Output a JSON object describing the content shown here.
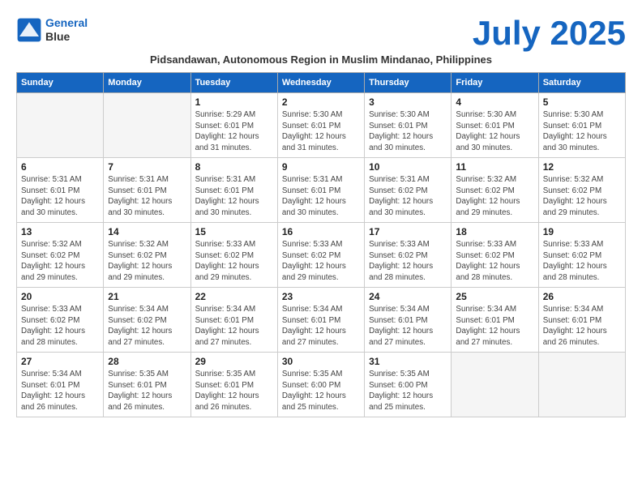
{
  "header": {
    "logo_line1": "General",
    "logo_line2": "Blue",
    "month_title": "July 2025",
    "subtitle": "Pidsandawan, Autonomous Region in Muslim Mindanao, Philippines"
  },
  "weekdays": [
    "Sunday",
    "Monday",
    "Tuesday",
    "Wednesday",
    "Thursday",
    "Friday",
    "Saturday"
  ],
  "weeks": [
    [
      {
        "day": "",
        "info": ""
      },
      {
        "day": "",
        "info": ""
      },
      {
        "day": "1",
        "info": "Sunrise: 5:29 AM\nSunset: 6:01 PM\nDaylight: 12 hours\nand 31 minutes."
      },
      {
        "day": "2",
        "info": "Sunrise: 5:30 AM\nSunset: 6:01 PM\nDaylight: 12 hours\nand 31 minutes."
      },
      {
        "day": "3",
        "info": "Sunrise: 5:30 AM\nSunset: 6:01 PM\nDaylight: 12 hours\nand 30 minutes."
      },
      {
        "day": "4",
        "info": "Sunrise: 5:30 AM\nSunset: 6:01 PM\nDaylight: 12 hours\nand 30 minutes."
      },
      {
        "day": "5",
        "info": "Sunrise: 5:30 AM\nSunset: 6:01 PM\nDaylight: 12 hours\nand 30 minutes."
      }
    ],
    [
      {
        "day": "6",
        "info": "Sunrise: 5:31 AM\nSunset: 6:01 PM\nDaylight: 12 hours\nand 30 minutes."
      },
      {
        "day": "7",
        "info": "Sunrise: 5:31 AM\nSunset: 6:01 PM\nDaylight: 12 hours\nand 30 minutes."
      },
      {
        "day": "8",
        "info": "Sunrise: 5:31 AM\nSunset: 6:01 PM\nDaylight: 12 hours\nand 30 minutes."
      },
      {
        "day": "9",
        "info": "Sunrise: 5:31 AM\nSunset: 6:01 PM\nDaylight: 12 hours\nand 30 minutes."
      },
      {
        "day": "10",
        "info": "Sunrise: 5:31 AM\nSunset: 6:02 PM\nDaylight: 12 hours\nand 30 minutes."
      },
      {
        "day": "11",
        "info": "Sunrise: 5:32 AM\nSunset: 6:02 PM\nDaylight: 12 hours\nand 29 minutes."
      },
      {
        "day": "12",
        "info": "Sunrise: 5:32 AM\nSunset: 6:02 PM\nDaylight: 12 hours\nand 29 minutes."
      }
    ],
    [
      {
        "day": "13",
        "info": "Sunrise: 5:32 AM\nSunset: 6:02 PM\nDaylight: 12 hours\nand 29 minutes."
      },
      {
        "day": "14",
        "info": "Sunrise: 5:32 AM\nSunset: 6:02 PM\nDaylight: 12 hours\nand 29 minutes."
      },
      {
        "day": "15",
        "info": "Sunrise: 5:33 AM\nSunset: 6:02 PM\nDaylight: 12 hours\nand 29 minutes."
      },
      {
        "day": "16",
        "info": "Sunrise: 5:33 AM\nSunset: 6:02 PM\nDaylight: 12 hours\nand 29 minutes."
      },
      {
        "day": "17",
        "info": "Sunrise: 5:33 AM\nSunset: 6:02 PM\nDaylight: 12 hours\nand 28 minutes."
      },
      {
        "day": "18",
        "info": "Sunrise: 5:33 AM\nSunset: 6:02 PM\nDaylight: 12 hours\nand 28 minutes."
      },
      {
        "day": "19",
        "info": "Sunrise: 5:33 AM\nSunset: 6:02 PM\nDaylight: 12 hours\nand 28 minutes."
      }
    ],
    [
      {
        "day": "20",
        "info": "Sunrise: 5:33 AM\nSunset: 6:02 PM\nDaylight: 12 hours\nand 28 minutes."
      },
      {
        "day": "21",
        "info": "Sunrise: 5:34 AM\nSunset: 6:02 PM\nDaylight: 12 hours\nand 27 minutes."
      },
      {
        "day": "22",
        "info": "Sunrise: 5:34 AM\nSunset: 6:01 PM\nDaylight: 12 hours\nand 27 minutes."
      },
      {
        "day": "23",
        "info": "Sunrise: 5:34 AM\nSunset: 6:01 PM\nDaylight: 12 hours\nand 27 minutes."
      },
      {
        "day": "24",
        "info": "Sunrise: 5:34 AM\nSunset: 6:01 PM\nDaylight: 12 hours\nand 27 minutes."
      },
      {
        "day": "25",
        "info": "Sunrise: 5:34 AM\nSunset: 6:01 PM\nDaylight: 12 hours\nand 27 minutes."
      },
      {
        "day": "26",
        "info": "Sunrise: 5:34 AM\nSunset: 6:01 PM\nDaylight: 12 hours\nand 26 minutes."
      }
    ],
    [
      {
        "day": "27",
        "info": "Sunrise: 5:34 AM\nSunset: 6:01 PM\nDaylight: 12 hours\nand 26 minutes."
      },
      {
        "day": "28",
        "info": "Sunrise: 5:35 AM\nSunset: 6:01 PM\nDaylight: 12 hours\nand 26 minutes."
      },
      {
        "day": "29",
        "info": "Sunrise: 5:35 AM\nSunset: 6:01 PM\nDaylight: 12 hours\nand 26 minutes."
      },
      {
        "day": "30",
        "info": "Sunrise: 5:35 AM\nSunset: 6:00 PM\nDaylight: 12 hours\nand 25 minutes."
      },
      {
        "day": "31",
        "info": "Sunrise: 5:35 AM\nSunset: 6:00 PM\nDaylight: 12 hours\nand 25 minutes."
      },
      {
        "day": "",
        "info": ""
      },
      {
        "day": "",
        "info": ""
      }
    ]
  ]
}
